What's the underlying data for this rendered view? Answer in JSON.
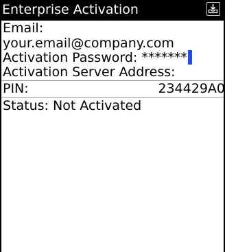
{
  "titlebar": {
    "title": "Enterprise Activation",
    "status_icon": "inbox-tray-icon"
  },
  "form": {
    "email_label": "Email:",
    "email_value": "your.email@company.com",
    "password_label": "Activation Password: ",
    "password_value": "*******",
    "server_label": "Activation Server Address:",
    "pin_label": "PIN:",
    "pin_value": "234429A0",
    "status_label": "Status: Not Activated"
  },
  "colors": {
    "titlebar_bg": "#000000",
    "cursor": "#1f4fe0",
    "divider": "#9a9a9a"
  }
}
